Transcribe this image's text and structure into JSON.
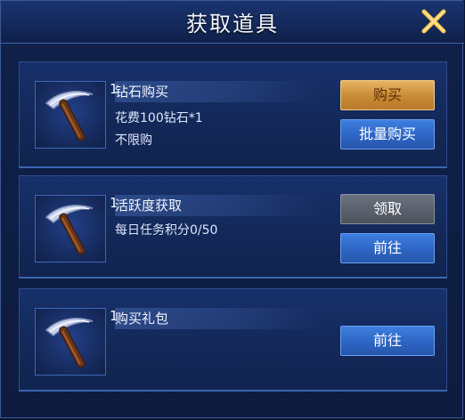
{
  "dialog": {
    "title": "获取道具",
    "close_icon": "close-x-icon",
    "accent_color": "#f0b43c"
  },
  "item": {
    "icon": "pickaxe-icon",
    "quantity": "1"
  },
  "sources": [
    {
      "name": "钻石购买",
      "lines": [
        "花费100钻石*1",
        "不限购"
      ],
      "buttons": [
        {
          "label": "购买",
          "style": "gold"
        },
        {
          "label": "批量购买",
          "style": "blue"
        }
      ]
    },
    {
      "name": "活跃度获取",
      "lines": [
        "每日任务积分0/50"
      ],
      "buttons": [
        {
          "label": "领取",
          "style": "gray"
        },
        {
          "label": "前往",
          "style": "blue"
        }
      ]
    },
    {
      "name": "购买礼包",
      "lines": [],
      "buttons": [
        {
          "label": "前往",
          "style": "blue"
        }
      ]
    }
  ]
}
